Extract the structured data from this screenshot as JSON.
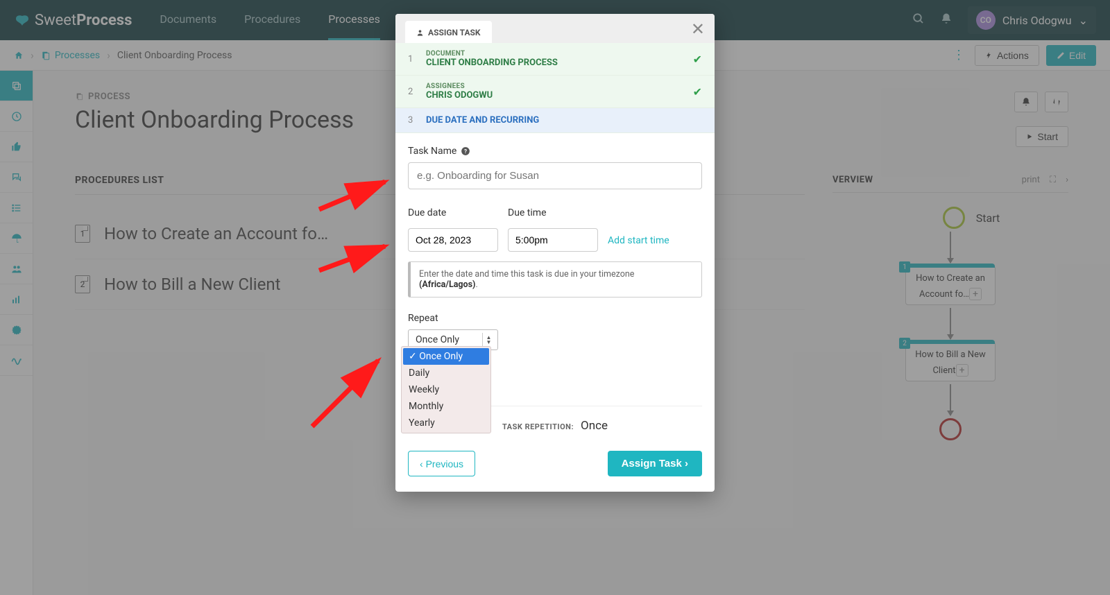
{
  "nav": {
    "brand_left": "Sweet",
    "brand_right": "Process",
    "links": [
      "Documents",
      "Procedures",
      "Processes"
    ],
    "active_index": 2,
    "user_initials": "CO",
    "user_name": "Chris Odogwu"
  },
  "breadcrumb": {
    "section": "Processes",
    "current": "Client Onboarding Process",
    "actions_btn": "Actions",
    "edit_btn": "Edit"
  },
  "page": {
    "eyebrow": "PROCESS",
    "title": "Client Onboarding Process",
    "start_btn": "Start",
    "procedures_heading": "PROCEDURES LIST",
    "procedures": [
      {
        "n": "1",
        "text": "How to Create an Account fo…"
      },
      {
        "n": "2",
        "text": "How to Bill a New Client"
      }
    ],
    "overview_heading": "VERVIEW",
    "ov_print": "print",
    "flow_start": "Start",
    "flow_nodes": [
      {
        "n": "1",
        "text": "How to Create an Account fo…"
      },
      {
        "n": "2",
        "text": "How to Bill a New Client"
      }
    ]
  },
  "modal": {
    "tab": "ASSIGN TASK",
    "steps": [
      {
        "n": "1",
        "label": "DOCUMENT",
        "value": "CLIENT ONBOARDING PROCESS",
        "done": true
      },
      {
        "n": "2",
        "label": "ASSIGNEES",
        "value": "CHRIS ODOGWU",
        "done": true
      },
      {
        "n": "3",
        "label": "",
        "value": "DUE DATE AND RECURRING",
        "done": false
      }
    ],
    "task_name_label": "Task Name",
    "task_name_placeholder": "e.g. Onboarding for Susan",
    "due_date_label": "Due date",
    "due_date_value": "Oct 28, 2023",
    "due_time_label": "Due time",
    "due_time_value": "5:00pm",
    "add_start": "Add start time",
    "hint_prefix": "Enter the date and time this task is due in your timezone ",
    "hint_bold": "(Africa/Lagos)",
    "hint_suffix": ".",
    "repeat_label": "Repeat",
    "repeat_selected": "Once Only",
    "repeat_options": [
      "Once Only",
      "Daily",
      "Weekly",
      "Monthly",
      "Yearly"
    ],
    "rep_label": "TASK REPETITION:",
    "rep_value": "Once",
    "prev_btn": "Previous",
    "assign_btn": "Assign Task"
  }
}
